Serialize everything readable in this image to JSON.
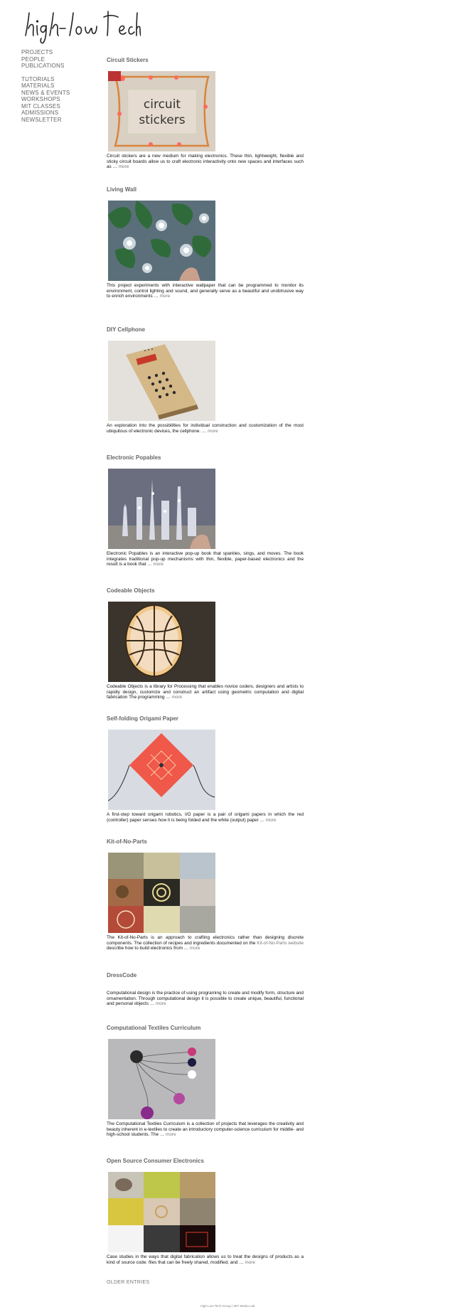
{
  "site": {
    "logo_text": "high-low tech"
  },
  "nav": {
    "group1": [
      {
        "label": "PROJECTS"
      },
      {
        "label": "PEOPLE"
      },
      {
        "label": "PUBLICATIONS"
      }
    ],
    "group2": [
      {
        "label": "TUTORIALS"
      },
      {
        "label": "MATERIALS"
      },
      {
        "label": "NEWS & EVENTS"
      },
      {
        "label": "WORKSHOPS"
      },
      {
        "label": "MIT CLASSES"
      },
      {
        "label": "ADMISSIONS"
      },
      {
        "label": "NEWSLETTER"
      }
    ]
  },
  "posts": [
    {
      "title": "Circuit Stickers",
      "image_label_line1": "circuit",
      "image_label_line2": "stickers",
      "excerpt": "Circuit stickers are a new medium for making electronics. These thin, lightweight, flexible and sticky circuit boards allow us to craft electronic interactivity onto new spaces and interfaces such as …",
      "more": "more"
    },
    {
      "title": "Living Wall",
      "excerpt": "This project experiments with interactive wallpaper that can be programmed to monitor its environment, control lighting and sound, and generally serve as a beautiful and unobtrusive way to enrich environments …",
      "more": "more"
    },
    {
      "title": "DIY Cellphone",
      "excerpt": "An exploration into the possibilities for individual construction and customization of the most ubiquitous of electronic devices, the cellphone. …",
      "more": "more"
    },
    {
      "title": "Electronic Popables",
      "excerpt": "Electronic Popables is an interactive pop-up book that sparkles, sings, and moves. The book integrates traditional pop-up mechanisms with thin, flexible, paper-based electronics and the result is a book that …",
      "more": "more"
    },
    {
      "title": "Codeable Objects",
      "excerpt": "Codeable Objects is a library for Processing that enables novice coders, designers and artists to rapidly design, customize and construct an artifact using geometric computation and digital fabrication The programming …",
      "more": "more"
    },
    {
      "title": "Self-folding Origami Paper",
      "excerpt": "A first-step toward origami robotics, I/O paper is a pair of origami papers in which the red (controller) paper senses how it is being folded and the white (output) paper …",
      "more": "more"
    },
    {
      "title": "Kit-of-No-Parts",
      "excerpt_before": "The Kit-of-No-Parts is an approach to crafting electronics rather than designing discrete components. The collection of recipes and ingredients documented on the",
      "link_text": "Kit-of-No-Parts website",
      "excerpt_after": "describe how to build electronics from …",
      "more": "more"
    },
    {
      "title": "DressCode",
      "excerpt": "Computational design is the practice of using programing to create and modify form, structure and ornamentation. Through computational design it is possible to create unique, beautiful, functional and personal objects …",
      "more": "more"
    },
    {
      "title": "Computational Textiles Curriculum",
      "excerpt": "The Computational Textiles Curriculum is a collection of projects that leverages the creativity and beauty inherent in e-textiles to create an introductory computer-science curriculum for middle- and high-school students. The …",
      "more": "more"
    },
    {
      "title": "Open Source Consumer Electronics",
      "excerpt": "Case studies in the ways that digital fabrication allows us to treat the designs of products as a kind of source code: files that can be freely shared, modified, and …",
      "more": "more"
    }
  ],
  "older_entries": "OLDER ENTRIES",
  "footer": "High-Low Tech Group  |  MIT Media Lab"
}
